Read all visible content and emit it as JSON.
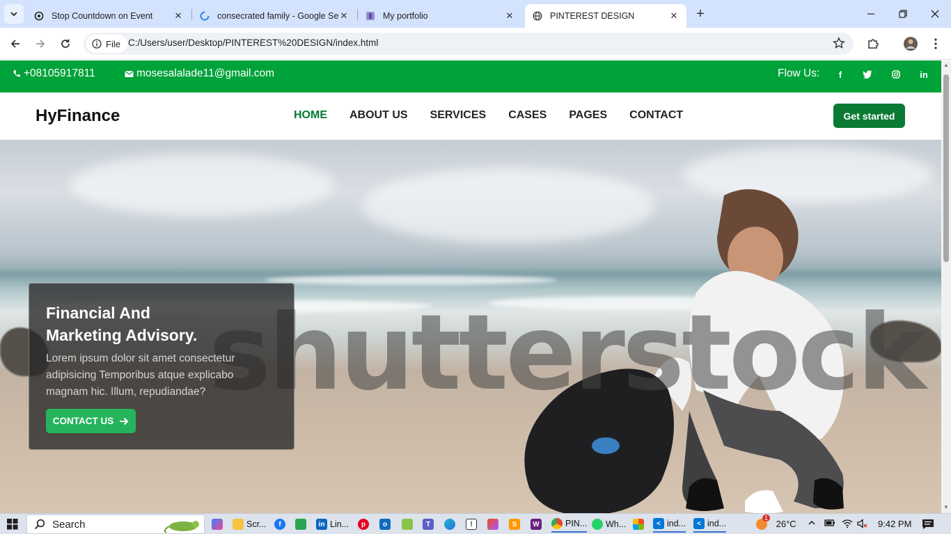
{
  "browser": {
    "tabs": [
      {
        "title": "Stop Countdown on Event",
        "active": false
      },
      {
        "title": "consecrated family - Google Se",
        "active": false
      },
      {
        "title": "My portfolio",
        "active": false
      },
      {
        "title": "PINTEREST DESIGN",
        "active": true
      }
    ],
    "scheme_chip": "File",
    "url": "C:/Users/user/Desktop/PINTEREST%20DESIGN/index.html"
  },
  "topbar": {
    "phone": "+08105917811",
    "email": "mosesalalade11@gmail.com",
    "follow_label": "Flow Us:",
    "socials": [
      "facebook-icon",
      "twitter-icon",
      "instagram-icon",
      "linkedin-icon"
    ]
  },
  "navbar": {
    "logo": "HyFinance",
    "menu": [
      "HOME",
      "ABOUT US",
      "SERVICES",
      "CASES",
      "PAGES",
      "CONTACT"
    ],
    "cta": "Get started"
  },
  "hero": {
    "watermark": "shutterstock",
    "title_line1": "Financial And",
    "title_line2": "Marketing Advisory.",
    "body": "Lorem ipsum dolor sit amet consectetur adipisicing Temporibus atque explicabo magnam hic. Illum, repudiandae?",
    "button": "CONTACT US"
  },
  "taskbar": {
    "search": "Search",
    "apps": [
      "Scr...",
      "Lin...",
      "PIN...",
      "Wh...",
      "ind...",
      "ind..."
    ],
    "weather": "26°C",
    "weather_badge": "1",
    "time": "9:42 PM"
  },
  "colors": {
    "topbar_green": "#00a23a",
    "nav_active": "#007a2f",
    "cta_green": "#0b7b34",
    "contact_button": "#25b45b"
  }
}
